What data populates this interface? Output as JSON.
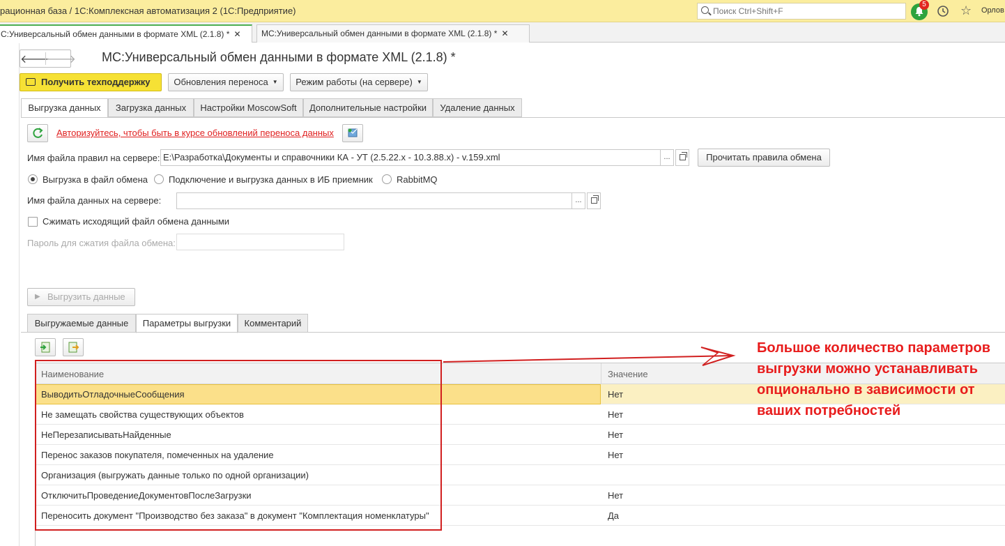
{
  "window": {
    "app_title": "рационная база / 1С:Комплексная автоматизация 2  (1С:Предприятие)",
    "search_placeholder": "Поиск Ctrl+Shift+F",
    "notifications_count": "5",
    "user": "Орлов"
  },
  "window_tabs": [
    {
      "label": "С:Универсальный обмен данными в формате XML (2.1.8) *",
      "active": true
    },
    {
      "label": "МС:Универсальный обмен данными в формате XML (2.1.8) *",
      "active": false
    }
  ],
  "form": {
    "title": "МС:Универсальный обмен данными в формате XML (2.1.8) *",
    "toolbar": {
      "support_label": "Получить техподдержку",
      "updates_label": "Обновления переноса",
      "mode_label": "Режим работы (на сервере)"
    },
    "tabs": [
      "Выгрузка данных",
      "Загрузка данных",
      "Настройки MoscowSoft",
      "Дополнительные настройки",
      "Удаление данных"
    ],
    "auth_link": "Авторизуйтесь, чтобы быть в курсе обновлений переноса данных",
    "rules_file_label": "Имя файла правил на сервере:",
    "rules_file_value": "E:\\Разработка\\Документы и справочники КА - УТ (2.5.22.x - 10.3.88.x) - v.159.xml",
    "read_rules_label": "Прочитать правила обмена",
    "field_btn_label": "...",
    "radios": [
      {
        "label": "Выгрузка в файл обмена",
        "checked": true
      },
      {
        "label": "Подключение и выгрузка данных в ИБ приемник",
        "checked": false
      },
      {
        "label": "RabbitMQ",
        "checked": false
      }
    ],
    "data_file_label": "Имя файла данных на сервере:",
    "data_file_value": "",
    "compress_label": "Сжимать исходящий файл обмена данными",
    "password_label": "Пароль для сжатия файла обмена:",
    "password_value": "",
    "export_button": "Выгрузить данные",
    "inner_tabs": [
      "Выгружаемые данные",
      "Параметры выгрузки",
      "Комментарий"
    ],
    "grid": {
      "columns": [
        "Наименование",
        "Значение"
      ],
      "rows": [
        {
          "name": "ВыводитьОтладочныеСообщения",
          "value": "Нет"
        },
        {
          "name": "Не замещать свойства существующих объектов",
          "value": "Нет"
        },
        {
          "name": "НеПерезаписыватьНайденные",
          "value": "Нет"
        },
        {
          "name": "Перенос заказов покупателя, помеченных на удаление",
          "value": "Нет"
        },
        {
          "name": "Организация (выгружать данные только по одной организации)",
          "value": ""
        },
        {
          "name": "ОтключитьПроведениеДокументовПослеЗагрузки",
          "value": "Нет"
        },
        {
          "name": "Переносить документ \"Производство без заказа\" в документ \"Комплектация номенклатуры\"",
          "value": "Да"
        }
      ]
    }
  },
  "annotation": {
    "lines": [
      "Большое количество параметров",
      "выгрузки можно устанавливать",
      "опционально в зависимости от",
      "ваших потребностей"
    ],
    "color": "#e81c1c"
  },
  "colors": {
    "titlebar": "#fbed9e",
    "accent_green": "#4caf50",
    "support_button": "#f6e135",
    "selected_row": "#fbe08a"
  }
}
